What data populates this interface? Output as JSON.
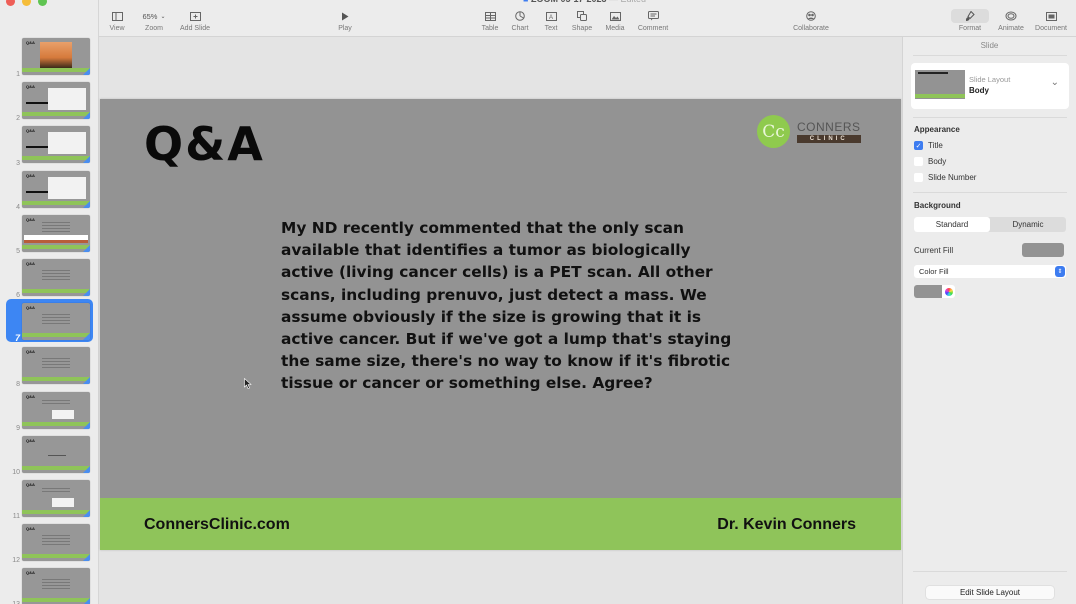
{
  "window": {
    "title": "ZOOM 05-17-2023",
    "title_status": "— Edited"
  },
  "toolbar": {
    "view_label": "View",
    "zoom_value": "65%",
    "zoom_label": "Zoom",
    "add_slide_label": "Add Slide",
    "play_label": "Play",
    "table_label": "Table",
    "chart_label": "Chart",
    "text_label": "Text",
    "shape_label": "Shape",
    "media_label": "Media",
    "comment_label": "Comment",
    "collaborate_label": "Collaborate",
    "format_label": "Format",
    "animate_label": "Animate",
    "document_label": "Document"
  },
  "navigator": {
    "selected_slide": 7,
    "slides": [
      {
        "number": "1",
        "title": "Q&A",
        "kind": "sunset"
      },
      {
        "number": "2",
        "title": "Q&A",
        "kind": "arrow-image"
      },
      {
        "number": "3",
        "title": "Q&A",
        "kind": "arrow-image"
      },
      {
        "number": "4",
        "title": "Q&A",
        "kind": "arrow-image"
      },
      {
        "number": "5",
        "title": "Q&A",
        "kind": "banner"
      },
      {
        "number": "6",
        "title": "Q&A",
        "kind": "text"
      },
      {
        "number": "7",
        "title": "Q&A",
        "kind": "text"
      },
      {
        "number": "8",
        "title": "Q&A",
        "kind": "text"
      },
      {
        "number": "9",
        "title": "Q&A",
        "kind": "text-image"
      },
      {
        "number": "10",
        "title": "Q&A",
        "kind": "line"
      },
      {
        "number": "11",
        "title": "Q&A",
        "kind": "text-image"
      },
      {
        "number": "12",
        "title": "Q&A",
        "kind": "text"
      },
      {
        "number": "13",
        "title": "Q&A",
        "kind": "text"
      }
    ]
  },
  "slide": {
    "title": "Q&A",
    "logo_top": "CONNERS",
    "logo_bottom": "CLINIC",
    "logo_mark": "Cc",
    "body": "My ND recently commented that the only scan available that identifies a tumor as biologically active (living cancer cells) is a PET scan. All other scans, including prenuvo, just detect a mass. We assume obviously if the size is growing that it is active cancer. But if we've got a lump that's staying the same size, there's no way to know if it's fibrotic tissue or cancer or something else. Agree?",
    "footer_left": "ConnersClinic.com",
    "footer_right": "Dr. Kevin Conners",
    "colors": {
      "background": "#939393",
      "footer": "#8fc45a",
      "logo_green": "#8fca4e"
    }
  },
  "inspector": {
    "tab": "Slide",
    "slide_layout_label": "Slide Layout",
    "slide_layout_value": "Body",
    "appearance_heading": "Appearance",
    "appearance": [
      {
        "label": "Title",
        "checked": true
      },
      {
        "label": "Body",
        "checked": false
      },
      {
        "label": "Slide Number",
        "checked": false
      }
    ],
    "background_heading": "Background",
    "background_modes": [
      "Standard",
      "Dynamic"
    ],
    "background_mode_selected": "Standard",
    "current_fill_label": "Current Fill",
    "fill_type": "Color Fill",
    "edit_layout_button": "Edit Slide Layout"
  }
}
